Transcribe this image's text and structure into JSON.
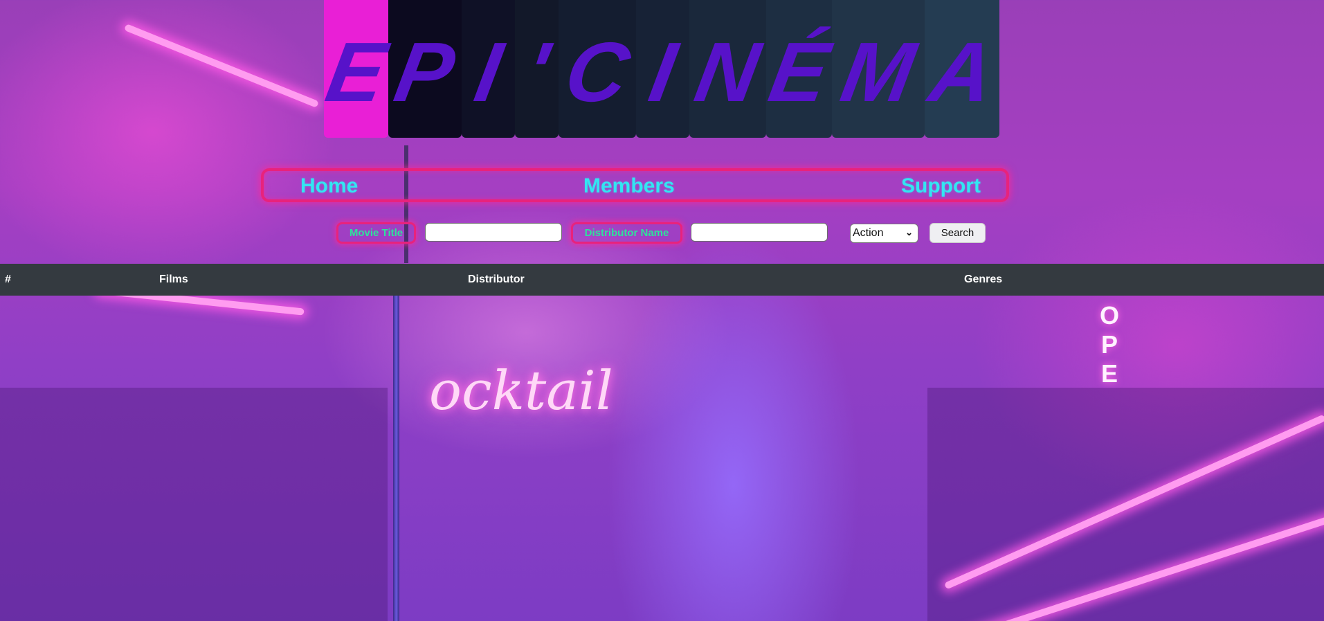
{
  "logo": {
    "letters": [
      "E",
      "P",
      "I",
      "'",
      "C",
      "I",
      "N",
      "É",
      "M",
      "A"
    ],
    "tile_colors": [
      "#e91fd6",
      "#0c0a1f",
      "#0f1126",
      "#121829",
      "#141d30",
      "#172236",
      "#1a283b",
      "#1d2e42",
      "#213448",
      "#243c52"
    ],
    "letter_color": "#5712c9"
  },
  "nav": {
    "home_label": "Home",
    "members_label": "Members",
    "support_label": "Support"
  },
  "search": {
    "movie_title_label": "Movie Title",
    "movie_title_value": "",
    "distributor_label": "Distributor Name",
    "distributor_value": "",
    "genre_selected": "Action",
    "button_label": "Search"
  },
  "table": {
    "columns": [
      "#",
      "Films",
      "Distributor",
      "Genres"
    ],
    "rows": []
  },
  "colors": {
    "neon_pink": "#e8237c",
    "nav_cyan": "#32e6f2",
    "label_green": "#2ee29c",
    "table_header_bg": "#343a40"
  }
}
